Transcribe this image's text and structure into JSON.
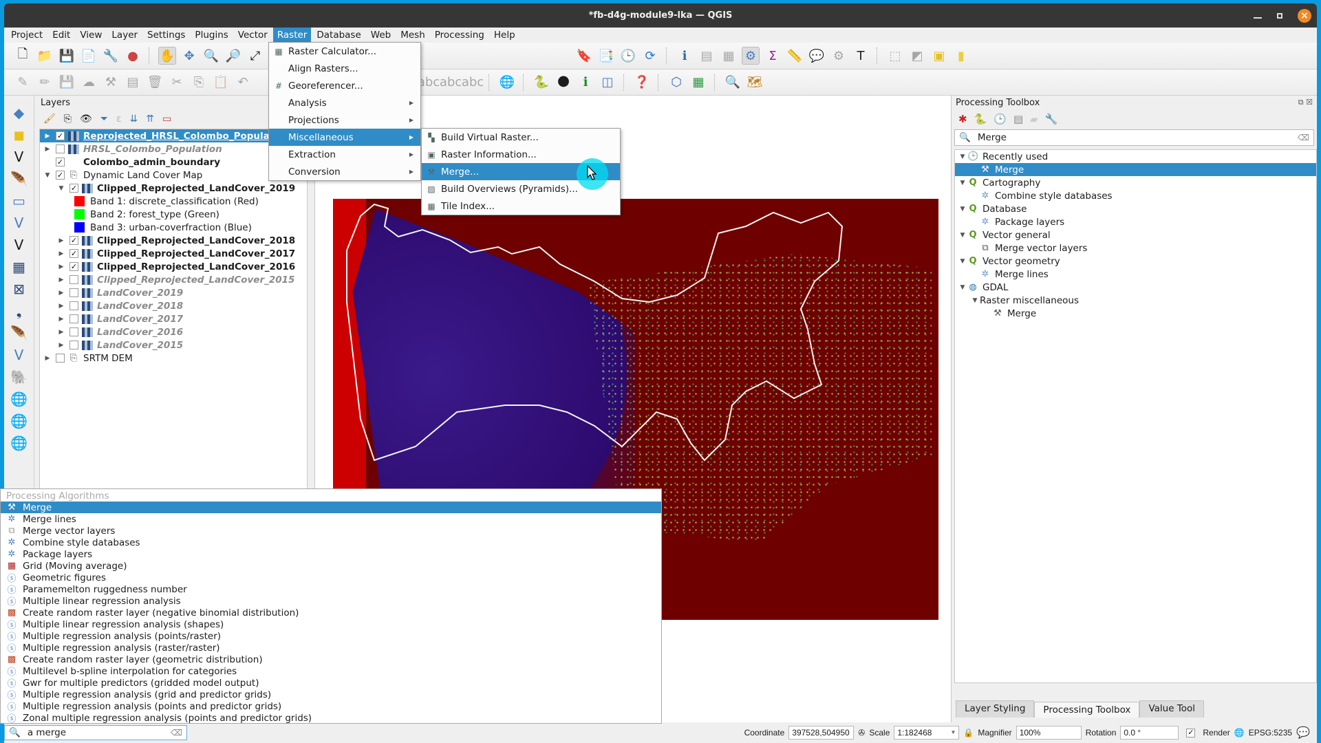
{
  "window": {
    "title": "*fb-d4g-module9-lka — QGIS"
  },
  "menubar": [
    "Project",
    "Edit",
    "View",
    "Layer",
    "Settings",
    "Plugins",
    "Vector",
    "Raster",
    "Database",
    "Web",
    "Mesh",
    "Processing",
    "Help"
  ],
  "menubar_active": "Raster",
  "raster_menu": {
    "items": [
      {
        "label": "Raster Calculator...",
        "icon": "raster-calculator-icon",
        "submenu": false
      },
      {
        "label": "Align Rasters...",
        "icon": "",
        "submenu": false
      },
      {
        "label": "Georeferencer...",
        "icon": "georeferencer-icon",
        "submenu": false
      },
      {
        "label": "Analysis",
        "icon": "",
        "submenu": true
      },
      {
        "label": "Projections",
        "icon": "",
        "submenu": true
      },
      {
        "label": "Miscellaneous",
        "icon": "",
        "submenu": true,
        "highlighted": true
      },
      {
        "label": "Extraction",
        "icon": "",
        "submenu": true
      },
      {
        "label": "Conversion",
        "icon": "",
        "submenu": true
      }
    ]
  },
  "misc_submenu": {
    "items": [
      {
        "label": "Build Virtual Raster...",
        "icon": "build-virtual-raster-icon"
      },
      {
        "label": "Raster Information...",
        "icon": "raster-information-icon"
      },
      {
        "label": "Merge...",
        "icon": "merge-icon",
        "highlighted": true
      },
      {
        "label": "Build Overviews (Pyramids)...",
        "icon": "build-overviews-icon"
      },
      {
        "label": "Tile Index...",
        "icon": "tile-index-icon"
      }
    ]
  },
  "layers_panel": {
    "title": "Layers",
    "layers": [
      {
        "name": "Reprojected_HRSL_Colombo_Population",
        "checked": true,
        "style": "bold-underline",
        "indent": 0,
        "expander": true,
        "selected": true,
        "type": "raster"
      },
      {
        "name": "HRSL_Colombo_Population",
        "checked": false,
        "style": "italic",
        "indent": 0,
        "expander": true,
        "type": "raster"
      },
      {
        "name": "Colombo_admin_boundary",
        "checked": true,
        "style": "bold",
        "indent": 0,
        "expander": false,
        "type": "vector"
      },
      {
        "name": "Dynamic Land Cover Map",
        "checked": true,
        "style": "normal",
        "indent": 0,
        "expander": true,
        "expanded": true,
        "type": "group"
      },
      {
        "name": "Clipped_Reprojected_LandCover_2019",
        "checked": true,
        "style": "bold",
        "indent": 1,
        "expander": true,
        "expanded": true,
        "type": "raster"
      },
      {
        "name": "Band 1: discrete_classification (Red)",
        "legend_color": "#ff0000",
        "indent": 2,
        "type": "legend"
      },
      {
        "name": "Band 2: forest_type (Green)",
        "legend_color": "#00ff00",
        "indent": 2,
        "type": "legend"
      },
      {
        "name": "Band 3: urban-coverfraction (Blue)",
        "legend_color": "#0000ff",
        "indent": 2,
        "type": "legend"
      },
      {
        "name": "Clipped_Reprojected_LandCover_2018",
        "checked": true,
        "style": "bold",
        "indent": 1,
        "expander": true,
        "type": "raster"
      },
      {
        "name": "Clipped_Reprojected_LandCover_2017",
        "checked": true,
        "style": "bold",
        "indent": 1,
        "expander": true,
        "type": "raster"
      },
      {
        "name": "Clipped_Reprojected_LandCover_2016",
        "checked": true,
        "style": "bold",
        "indent": 1,
        "expander": true,
        "type": "raster"
      },
      {
        "name": "Clipped_Reprojected_LandCover_2015",
        "checked": false,
        "style": "italic",
        "indent": 1,
        "expander": true,
        "type": "raster"
      },
      {
        "name": "LandCover_2019",
        "checked": false,
        "style": "italic",
        "indent": 1,
        "expander": true,
        "type": "raster"
      },
      {
        "name": "LandCover_2018",
        "checked": false,
        "style": "italic",
        "indent": 1,
        "expander": true,
        "type": "raster"
      },
      {
        "name": "LandCover_2017",
        "checked": false,
        "style": "italic",
        "indent": 1,
        "expander": true,
        "type": "raster"
      },
      {
        "name": "LandCover_2016",
        "checked": false,
        "style": "italic",
        "indent": 1,
        "expander": true,
        "type": "raster"
      },
      {
        "name": "LandCover_2015",
        "checked": false,
        "style": "italic",
        "indent": 1,
        "expander": true,
        "type": "raster"
      },
      {
        "name": "SRTM DEM",
        "checked": false,
        "style": "normal",
        "indent": 0,
        "expander": true,
        "type": "group"
      }
    ]
  },
  "locator": {
    "header": "Processing Algorithms",
    "results": [
      {
        "label": "Merge",
        "icon": "merge-icon",
        "selected": true
      },
      {
        "label": "Merge lines",
        "icon": "gear-icon"
      },
      {
        "label": "Merge vector layers",
        "icon": "merge-vector-icon"
      },
      {
        "label": "Combine style databases",
        "icon": "gear-icon"
      },
      {
        "label": "Package layers",
        "icon": "gear-icon"
      },
      {
        "label": "Grid (Moving average)",
        "icon": "grid-icon"
      },
      {
        "label": "Geometric figures",
        "icon": "saga-icon"
      },
      {
        "label": "Paramemelton ruggedness number",
        "icon": "saga-icon"
      },
      {
        "label": "Multiple linear regression analysis",
        "icon": "saga-icon"
      },
      {
        "label": "Create random raster layer (negative binomial distribution)",
        "icon": "random-raster-icon"
      },
      {
        "label": "Multiple linear regression analysis (shapes)",
        "icon": "saga-icon"
      },
      {
        "label": "Multiple regression analysis (points/raster)",
        "icon": "saga-icon"
      },
      {
        "label": "Multiple regression analysis (raster/raster)",
        "icon": "saga-icon"
      },
      {
        "label": "Create random raster layer (geometric distribution)",
        "icon": "random-raster-icon"
      },
      {
        "label": "Multilevel b-spline interpolation for categories",
        "icon": "saga-icon"
      },
      {
        "label": "Gwr for multiple predictors (gridded model output)",
        "icon": "saga-icon"
      },
      {
        "label": "Multiple regression analysis (grid and predictor grids)",
        "icon": "saga-icon"
      },
      {
        "label": "Multiple regression analysis (points and predictor grids)",
        "icon": "saga-icon"
      },
      {
        "label": "Zonal multiple regression analysis (points and predictor grids)",
        "icon": "saga-icon"
      }
    ],
    "search_value": "a merge"
  },
  "toolbox": {
    "title": "Processing Toolbox",
    "search_value": "Merge",
    "tree": [
      {
        "label": "Recently used",
        "level": 0,
        "icon": "clock-icon",
        "expander": true
      },
      {
        "label": "Merge",
        "level": 1,
        "icon": "merge-icon",
        "selected": true
      },
      {
        "label": "Cartography",
        "level": 0,
        "icon": "qgis-icon",
        "expander": true
      },
      {
        "label": "Combine style databases",
        "level": 1,
        "icon": "gear-icon"
      },
      {
        "label": "Database",
        "level": 0,
        "icon": "qgis-icon",
        "expander": true
      },
      {
        "label": "Package layers",
        "level": 1,
        "icon": "gear-icon"
      },
      {
        "label": "Vector general",
        "level": 0,
        "icon": "qgis-icon",
        "expander": true
      },
      {
        "label": "Merge vector layers",
        "level": 1,
        "icon": "merge-vector-icon"
      },
      {
        "label": "Vector geometry",
        "level": 0,
        "icon": "qgis-icon",
        "expander": true
      },
      {
        "label": "Merge lines",
        "level": 1,
        "icon": "gear-icon"
      },
      {
        "label": "GDAL",
        "level": 0,
        "icon": "gdal-icon",
        "expander": true
      },
      {
        "label": "Raster miscellaneous",
        "level": 1,
        "icon": "",
        "expander": true
      },
      {
        "label": "Merge",
        "level": 2,
        "icon": "merge-icon"
      }
    ],
    "tabs": [
      {
        "label": "Layer Styling",
        "active": false
      },
      {
        "label": "Processing Toolbox",
        "active": true
      },
      {
        "label": "Value Tool",
        "active": false
      }
    ]
  },
  "statusbar": {
    "coordinate_label": "Coordinate",
    "coordinate_value": "397528,504950",
    "scale_label": "Scale",
    "scale_value": "1:182468",
    "magnifier_label": "Magnifier",
    "magnifier_value": "100%",
    "rotation_label": "Rotation",
    "rotation_value": "0.0 °",
    "render_label": "Render",
    "render_checked": true,
    "crs": "EPSG:5235"
  },
  "colors": {
    "accent": "#308cc6",
    "titlebar": "#363636",
    "close": "#f08a24",
    "desktop": "#0a9ae0"
  }
}
